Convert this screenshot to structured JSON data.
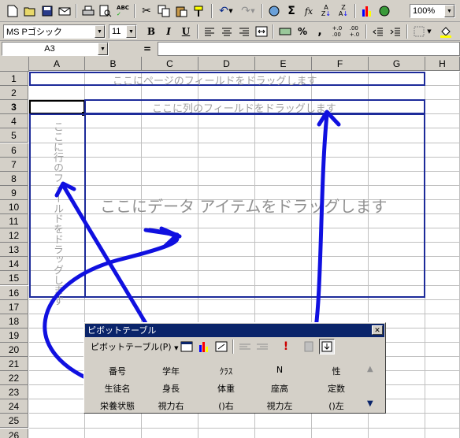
{
  "toolbar": {
    "zoom": "100%",
    "font_name": "MS Pゴシック",
    "font_size": "11",
    "bold": "B",
    "italic": "I",
    "underline": "U",
    "percent": "%",
    "comma": ",",
    "fx": "fx"
  },
  "formula_bar": {
    "name_box": "A3",
    "equals": "="
  },
  "columns": [
    "A",
    "B",
    "C",
    "D",
    "E",
    "F",
    "G",
    "H"
  ],
  "rows": [
    "1",
    "2",
    "3",
    "4",
    "5",
    "6",
    "7",
    "8",
    "9",
    "10",
    "11",
    "12",
    "13",
    "14",
    "15",
    "16",
    "17",
    "18",
    "19",
    "20",
    "21",
    "22",
    "23",
    "24",
    "25",
    "26"
  ],
  "drop_zones": {
    "page": "ここにページのフィールドをドラッグします",
    "column": "ここに列のフィールドをドラッグします",
    "row": "ここに行のフィールドをドラッグします",
    "data": "ここにデータ アイテムをドラッグします"
  },
  "pivot_toolbar": {
    "title": "ピボットテーブル",
    "menu_label": "ピボットテーブル(P)",
    "close": "✕",
    "fields": [
      [
        "番号",
        "学年",
        "ｸﾗｽ",
        "N",
        "性"
      ],
      [
        "生徒名",
        "身長",
        "体重",
        "座高",
        "定数"
      ],
      [
        "栄養状態",
        "視力右",
        "()右",
        "視力左",
        "()左"
      ]
    ]
  }
}
